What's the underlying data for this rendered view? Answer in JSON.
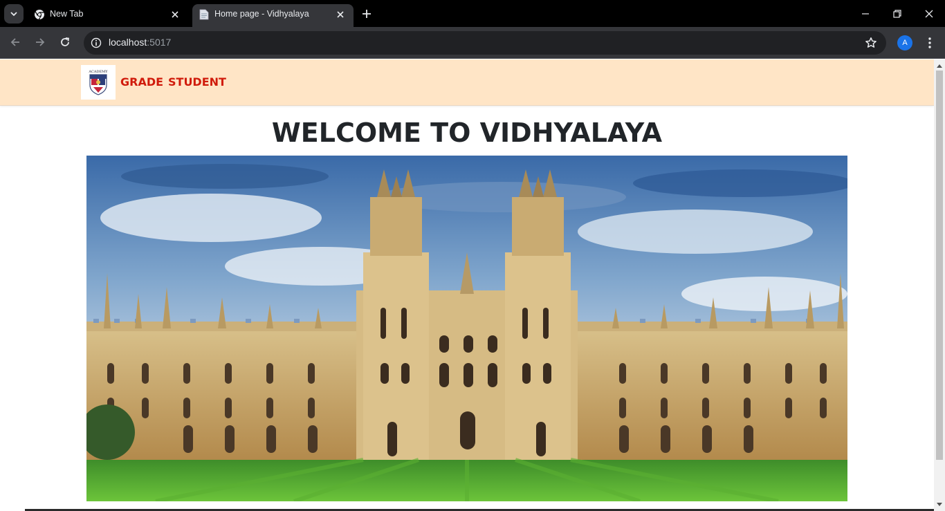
{
  "browser": {
    "tabs": [
      {
        "title": "New Tab",
        "favicon": "chrome-icon",
        "active": false
      },
      {
        "title": "Home page - Vidhyalaya",
        "favicon": "page-icon",
        "active": true
      }
    ],
    "url": {
      "host": "localhost",
      "port": ":5017"
    },
    "profile_initial": "A"
  },
  "site": {
    "logo_text": "ACADEMY",
    "nav": {
      "grade": "GRADE",
      "student": "STUDENT"
    },
    "heading": "WELCOME TO VIDHYALAYA",
    "hero_image": "gothic-college-building-painting"
  },
  "colors": {
    "navbar_bg": "#ffe5c6",
    "nav_link": "#d01b0b",
    "heading": "#212529",
    "chrome_dark": "#35363a"
  }
}
